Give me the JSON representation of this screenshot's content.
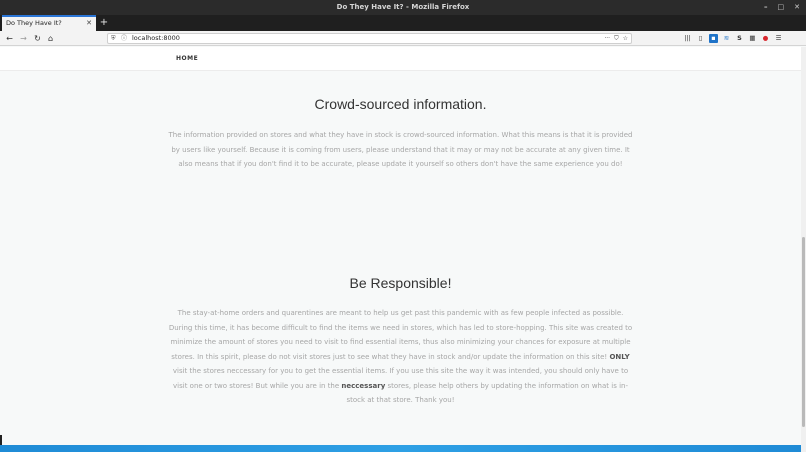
{
  "window": {
    "title": "Do They Have It? - Mozilla Firefox",
    "controls": [
      "–",
      "□",
      "✕"
    ]
  },
  "tabs": [
    {
      "label": "Do They Have It?",
      "close": "✕"
    }
  ],
  "new_tab_label": "+",
  "nav": {
    "back": "←",
    "forward": "→",
    "reload": "↻",
    "home": "⌂",
    "url": "localhost:8000",
    "page_actions": "···",
    "pocket": "⛉",
    "bookmark": "☆"
  },
  "toolbar_icons": [
    "library-icon",
    "sidebar-icon",
    "extension-blue-icon",
    "extension-s-icon",
    "extension-ink-icon",
    "extension-grid-icon",
    "extension-red-icon",
    "menu-icon"
  ],
  "site": {
    "nav_home": "HOME",
    "section1": {
      "title": "Crowd-sourced information.",
      "text": "The information provided on stores and what they have in stock is crowd-sourced information. What this means is that it is provided by users like yourself. Because it is coming from users, please understand that it may or may not be accurate at any given time. It also means that if you don't find it to be accurate, please update it yourself so others don't have the same experience you do!"
    },
    "section2": {
      "title": "Be Responsible!",
      "text_a": "The stay-at-home orders and quarentines are meant to help us get past this pandemic with as few people infected as possible. During this time, it has become difficult to find the items we need in stores, which has led to store-hopping. This site was created to minimize the amount of stores you need to visit to find essential items, thus also minimizing your chances for exposure at multiple stores. In this spirit, please do not visit stores just to see what they have in stock and/or update the information on this site! ",
      "strong_only": "ONLY",
      "text_b": " visit the stores neccessary for you to get the essential items. If you use this site the way it was intended, you should only have to visit one or two stores! But while you are in the ",
      "strong_neccessary": "neccessary",
      "text_c": " stores, please help others by updating the information on what is in-stock at that store. Thank you!"
    }
  },
  "colors": {
    "accent_blue": "#1f8bd6",
    "tab_highlight": "#2a75d6",
    "muted_text": "#a6a6a6"
  }
}
